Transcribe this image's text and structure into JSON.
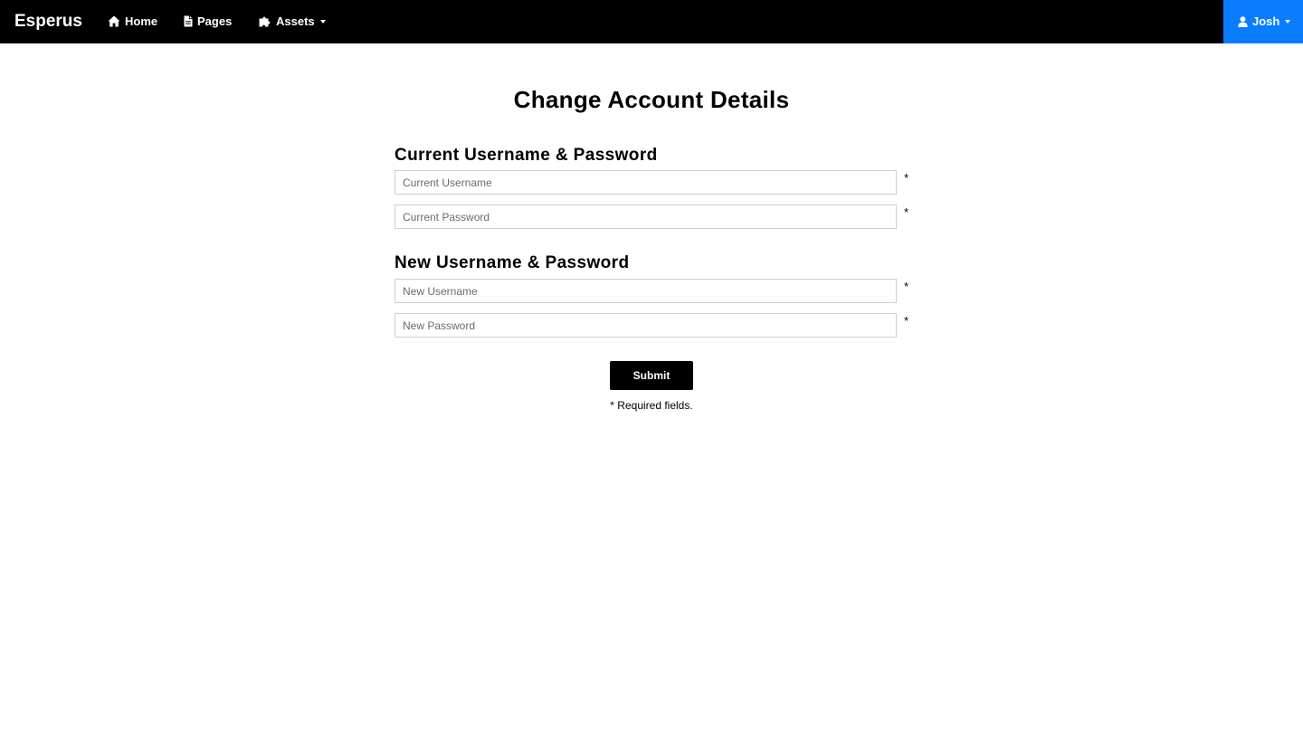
{
  "navbar": {
    "brand": "Esperus",
    "items": [
      {
        "label": "Home",
        "icon": "home-icon"
      },
      {
        "label": "Pages",
        "icon": "file-icon"
      },
      {
        "label": "Assets",
        "icon": "puzzle-icon",
        "dropdown": true
      }
    ],
    "user": {
      "label": "Josh",
      "icon": "user-icon",
      "dropdown": true,
      "color": "#0a7cff"
    }
  },
  "main": {
    "title": "Change Account Details",
    "current_section": {
      "title": "Current Username & Password",
      "username_placeholder": "Current Username",
      "password_placeholder": "Current Password"
    },
    "new_section": {
      "title": "New Username & Password",
      "username_placeholder": "New Username",
      "password_placeholder": "New Password"
    },
    "required_mark": "*",
    "submit_label": "Submit",
    "required_note": "* Required fields."
  }
}
